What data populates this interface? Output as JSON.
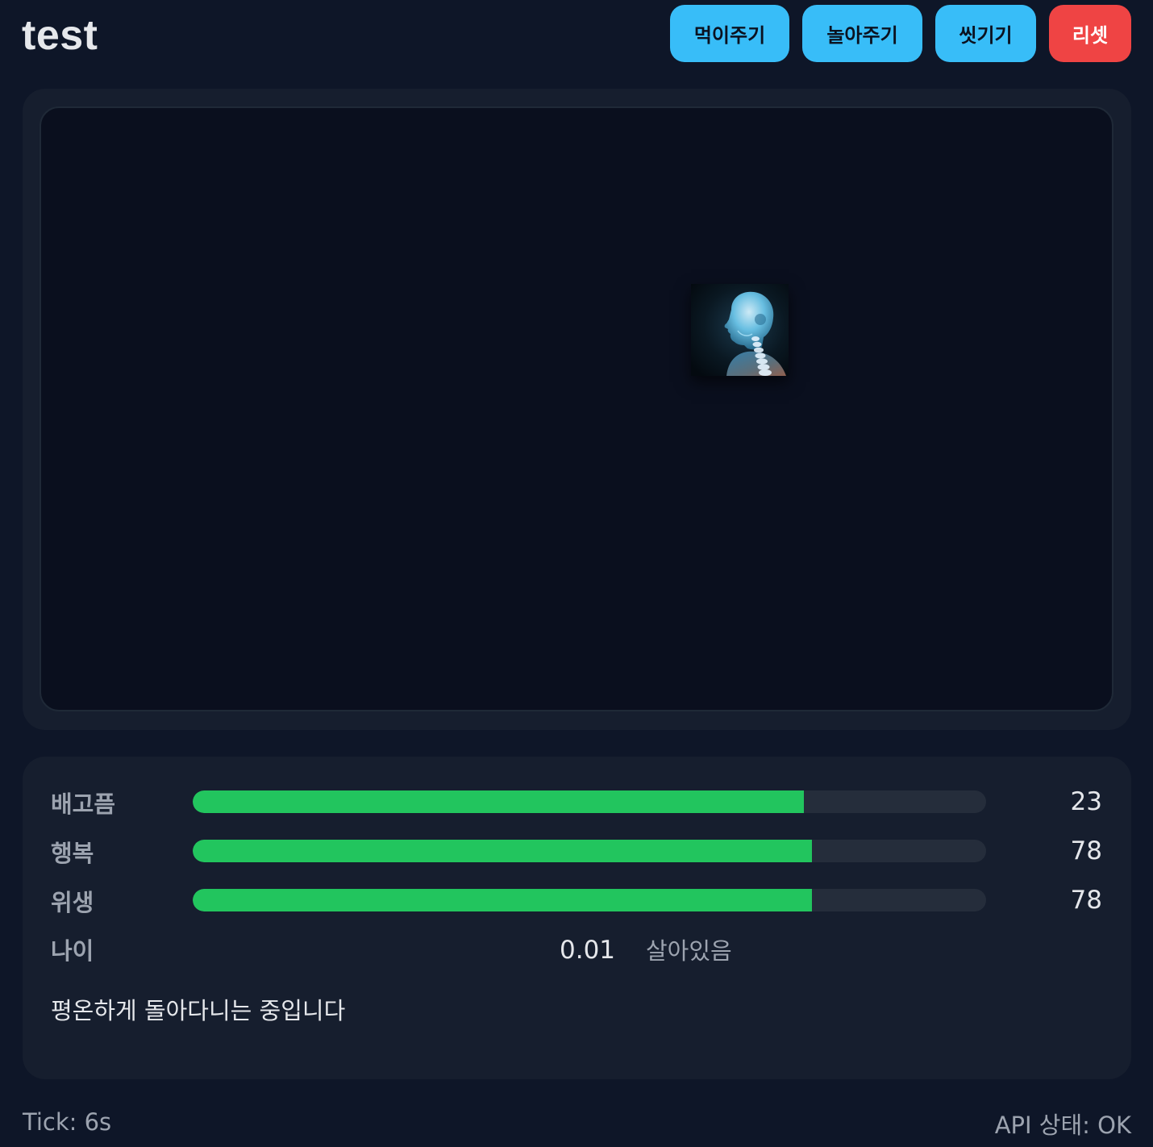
{
  "header": {
    "title": "test"
  },
  "actions": {
    "feed_label": "먹이주기",
    "play_label": "놀아주기",
    "wash_label": "씻기기",
    "reset_label": "리셋"
  },
  "pet": {
    "image": "xray-head-spine-image"
  },
  "stats": {
    "hunger": {
      "label": "배고픔",
      "value": "23",
      "fill": 0.77
    },
    "happiness": {
      "label": "행복",
      "value": "78",
      "fill": 0.78
    },
    "hygiene": {
      "label": "위생",
      "value": "78",
      "fill": 0.78
    },
    "age": {
      "label": "나이",
      "value": "0.01",
      "status": "살아있음"
    },
    "message": "평온하게 돌아다니는 중입니다"
  },
  "footer": {
    "tick": "Tick: 6s",
    "api_status": "API 상태: OK"
  },
  "colors": {
    "background": "#0e1628",
    "card": "#161e2e",
    "stage": "#0a0f1e",
    "primary_button": "#38bdf8",
    "danger_button": "#ef4444",
    "bar_fill": "#22c55e",
    "bar_track": "#252d3b"
  }
}
